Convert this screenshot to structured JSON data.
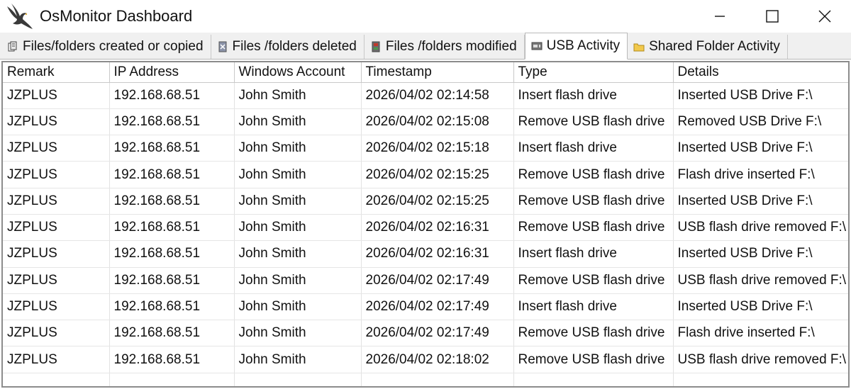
{
  "window": {
    "title": "OsMonitor Dashboard",
    "logo_icon": "eagle-icon",
    "controls": [
      "minimize-icon",
      "maximize-icon",
      "close-icon"
    ]
  },
  "tabs": [
    {
      "label": "Files/folders created or copied",
      "icon": "file-copy-icon",
      "active": false
    },
    {
      "label": "Files /folders deleted",
      "icon": "file-delete-icon",
      "active": false
    },
    {
      "label": "Files /folders modified",
      "icon": "file-modify-icon",
      "active": false
    },
    {
      "label": "USB Activity",
      "icon": "usb-icon",
      "active": true
    },
    {
      "label": "Shared Folder Activity",
      "icon": "folder-icon",
      "active": false
    }
  ],
  "table": {
    "columns": [
      "Remark",
      "IP Address",
      "Windows Account",
      "Timestamp",
      "Type",
      "Details"
    ],
    "rows": [
      [
        "JZPLUS",
        "192.168.68.51",
        "John Smith",
        "2026/04/02 02:14:58",
        "Insert flash drive",
        "Inserted USB Drive F:\\"
      ],
      [
        "JZPLUS",
        "192.168.68.51",
        "John Smith",
        "2026/04/02 02:15:08",
        "Remove USB flash drive",
        "Removed USB Drive F:\\"
      ],
      [
        "JZPLUS",
        "192.168.68.51",
        "John Smith",
        "2026/04/02 02:15:18",
        "Insert flash drive",
        "Inserted USB Drive F:\\"
      ],
      [
        "JZPLUS",
        "192.168.68.51",
        "John Smith",
        "2026/04/02 02:15:25",
        "Remove USB flash drive",
        "Flash drive inserted F:\\"
      ],
      [
        "JZPLUS",
        "192.168.68.51",
        "John Smith",
        "2026/04/02 02:15:25",
        "Remove USB flash drive",
        "Inserted USB Drive F:\\"
      ],
      [
        "JZPLUS",
        "192.168.68.51",
        "John Smith",
        "2026/04/02 02:16:31",
        "Remove USB flash drive",
        "USB flash drive removed F:\\"
      ],
      [
        "JZPLUS",
        "192.168.68.51",
        "John Smith",
        "2026/04/02 02:16:31",
        "Insert flash drive",
        "Inserted USB Drive F:\\"
      ],
      [
        "JZPLUS",
        "192.168.68.51",
        "John Smith",
        "2026/04/02 02:17:49",
        "Remove USB flash drive",
        "USB flash drive removed F:\\"
      ],
      [
        "JZPLUS",
        "192.168.68.51",
        "John Smith",
        "2026/04/02 02:17:49",
        "Insert flash drive",
        "Inserted USB Drive F:\\"
      ],
      [
        "JZPLUS",
        "192.168.68.51",
        "John Smith",
        "2026/04/02 02:17:49",
        "Remove USB flash drive",
        "Flash drive inserted F:\\"
      ],
      [
        "JZPLUS",
        "192.168.68.51",
        "John Smith",
        "2026/04/02 02:18:02",
        "Remove USB flash drive",
        "USB flash drive removed F:\\"
      ]
    ]
  }
}
